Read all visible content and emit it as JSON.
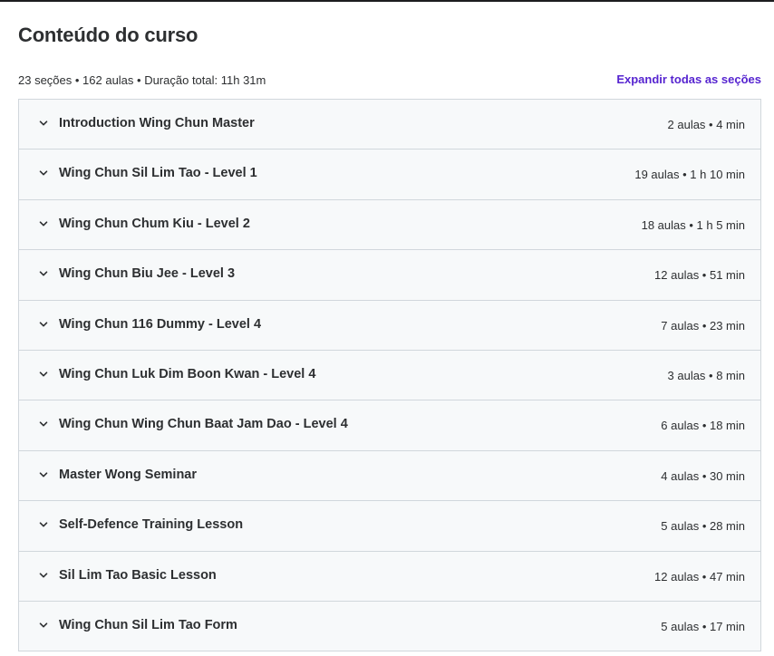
{
  "header": {
    "title": "Conteúdo do curso"
  },
  "summary": {
    "text": "23 seções • 162 aulas • Duração total: 11h 31m",
    "expand_all_label": "Expandir todas as seções"
  },
  "sections": [
    {
      "title": "Introduction Wing Chun Master",
      "meta": "2 aulas • 4 min",
      "icon": "chevron-down-icon"
    },
    {
      "title": "Wing Chun Sil Lim Tao - Level 1",
      "meta": "19 aulas • 1 h 10 min",
      "icon": "chevron-down-icon"
    },
    {
      "title": "Wing Chun Chum Kiu - Level 2",
      "meta": "18 aulas • 1 h 5 min",
      "icon": "chevron-down-icon"
    },
    {
      "title": "Wing Chun Biu Jee - Level 3",
      "meta": "12 aulas • 51 min",
      "icon": "chevron-down-icon"
    },
    {
      "title": "Wing Chun 116 Dummy - Level 4",
      "meta": "7 aulas • 23 min",
      "icon": "chevron-down-icon"
    },
    {
      "title": "Wing Chun Luk Dim Boon Kwan - Level 4",
      "meta": "3 aulas • 8 min",
      "icon": "chevron-down-icon"
    },
    {
      "title": "Wing Chun Wing Chun Baat Jam Dao - Level 4",
      "meta": "6 aulas • 18 min",
      "icon": "chevron-down-icon"
    },
    {
      "title": "Master Wong Seminar",
      "meta": "4 aulas • 30 min",
      "icon": "chevron-down-icon"
    },
    {
      "title": "Self-Defence Training Lesson",
      "meta": "5 aulas • 28 min",
      "icon": "chevron-down-icon"
    },
    {
      "title": "Sil Lim Tao Basic Lesson",
      "meta": "12 aulas • 47 min",
      "icon": "chevron-down-icon"
    },
    {
      "title": "Wing Chun Sil Lim Tao Form",
      "meta": "5 aulas • 17 min",
      "icon": "chevron-down-icon"
    }
  ],
  "colors": {
    "accent": "#5624d0",
    "text": "#2d2f31",
    "row_bg": "#f7f9fa",
    "border": "#d1d7dc"
  }
}
